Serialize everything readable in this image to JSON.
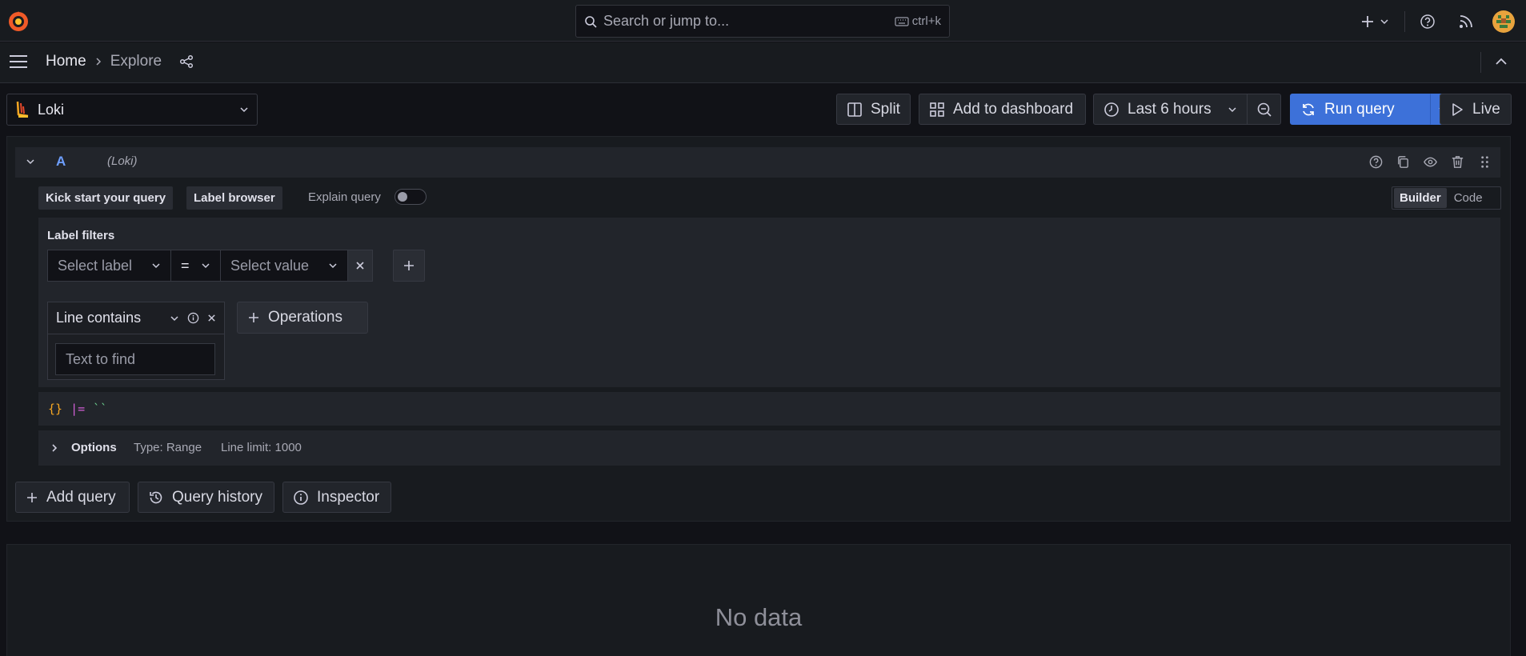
{
  "search": {
    "placeholder": "Search or jump to...",
    "shortcut": "ctrl+k"
  },
  "breadcrumb": {
    "home": "Home",
    "current": "Explore"
  },
  "datasource": {
    "name": "Loki"
  },
  "toolbar": {
    "split": "Split",
    "add_to_dashboard": "Add to dashboard",
    "time_range": "Last 6 hours",
    "run_query": "Run query",
    "live": "Live"
  },
  "query": {
    "ref_id": "A",
    "datasource_label": "(Loki)",
    "kick_start": "Kick start your query",
    "label_browser": "Label browser",
    "explain_query": "Explain query",
    "explain_enabled": false,
    "mode_builder": "Builder",
    "mode_code": "Code",
    "label_filters_title": "Label filters",
    "select_label": "Select label",
    "operator": "=",
    "select_value": "Select value",
    "line_contains": "Line contains",
    "text_placeholder": "Text to find",
    "operations": "Operations",
    "raw_braces": "{}",
    "raw_op": "|=",
    "raw_str": "``",
    "options_label": "Options",
    "options_type": "Type: Range",
    "options_limit": "Line limit: 1000"
  },
  "actions": {
    "add_query": "Add query",
    "query_history": "Query history",
    "inspector": "Inspector"
  },
  "result": {
    "no_data": "No data"
  },
  "colors": {
    "accent": "#3d71d9",
    "brand": "#f05a28",
    "ref_id": "#6e9fff"
  }
}
